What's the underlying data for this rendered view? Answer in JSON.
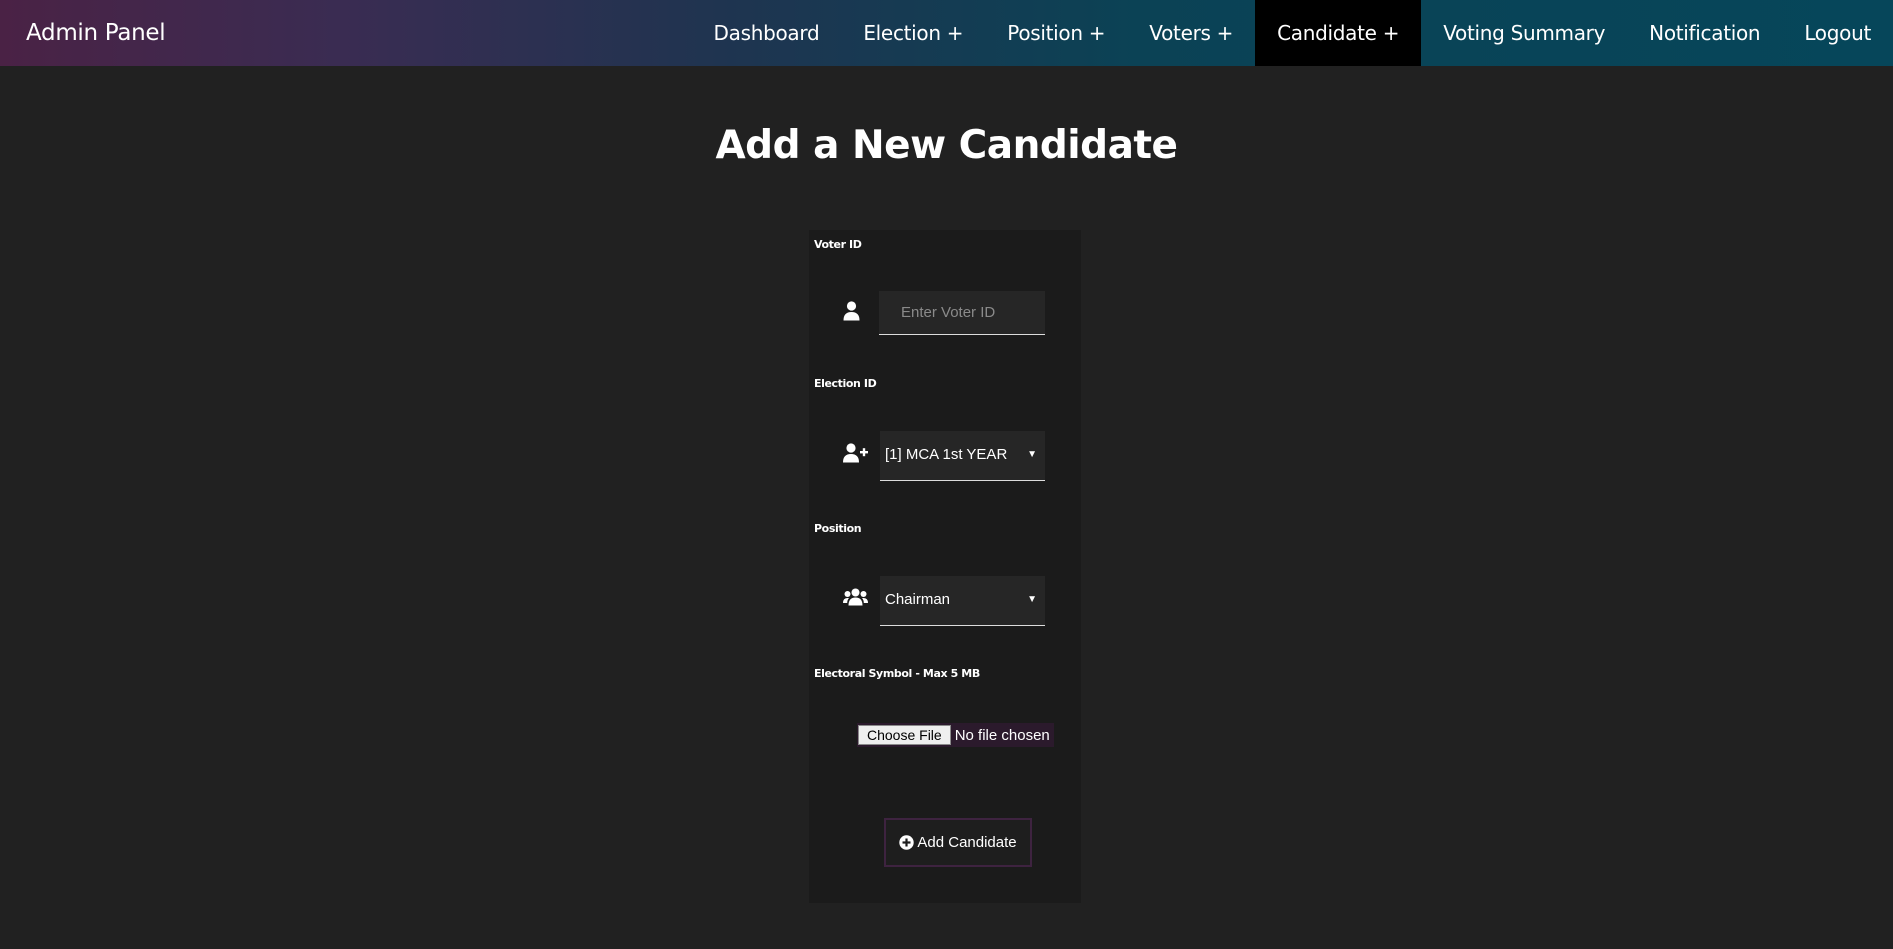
{
  "brand": "Admin Panel",
  "nav": [
    {
      "label": "Dashboard",
      "active": false
    },
    {
      "label": "Election +",
      "active": false
    },
    {
      "label": "Position +",
      "active": false
    },
    {
      "label": "Voters +",
      "active": false
    },
    {
      "label": "Candidate +",
      "active": true
    },
    {
      "label": "Voting Summary",
      "active": false
    },
    {
      "label": "Notification",
      "active": false
    },
    {
      "label": "Logout",
      "active": false
    }
  ],
  "page_title": "Add a New Candidate",
  "form": {
    "voter_id": {
      "label": "Voter ID",
      "placeholder": "Enter Voter ID",
      "value": "",
      "icon": "user-icon"
    },
    "election_id": {
      "label": "Election ID",
      "selected": "[1] MCA 1st YEAR",
      "icon": "user-plus-icon"
    },
    "position": {
      "label": "Position",
      "selected": "Chairman",
      "icon": "users-icon"
    },
    "symbol": {
      "label": "Electoral Symbol - Max 5 MB",
      "button": "Choose File",
      "status": "No file chosen"
    },
    "submit": {
      "label": "Add Candidate",
      "icon": "plus-circle-icon"
    }
  },
  "colors": {
    "background": "#212121",
    "card": "#1b1b1b",
    "active_nav": "#000000",
    "nav_gradient_start": "#4a2245",
    "nav_gradient_end": "#06465a",
    "button_border": "#3e2340"
  }
}
